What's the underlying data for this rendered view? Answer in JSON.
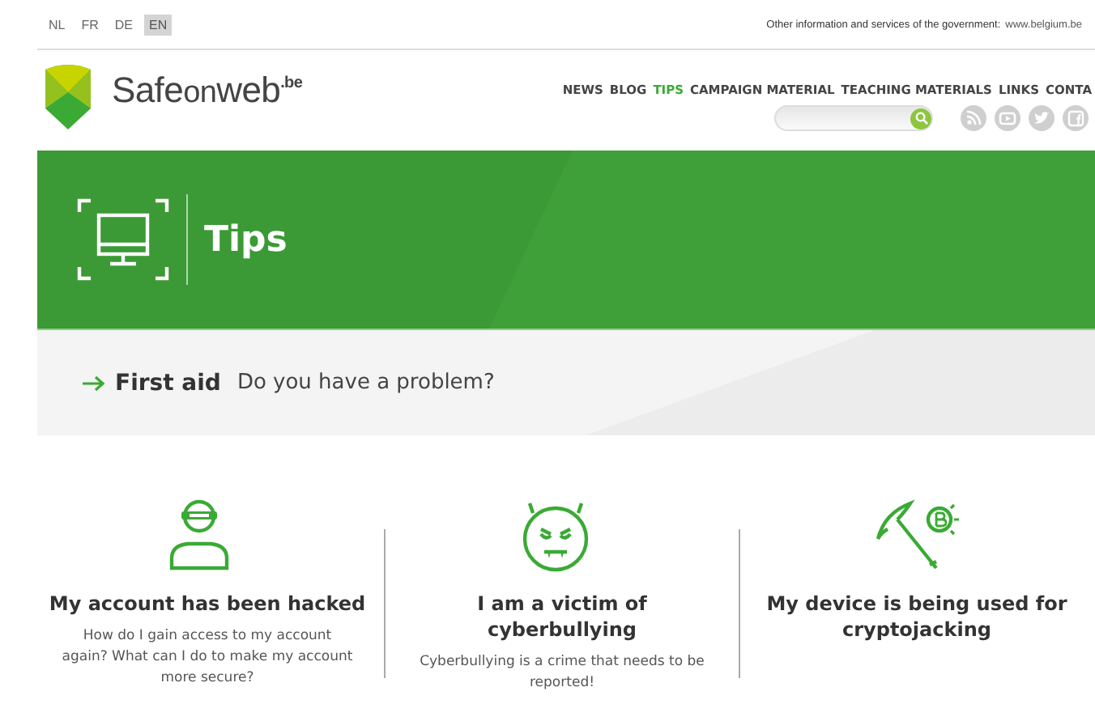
{
  "languages": [
    {
      "label": "NL",
      "selected": false
    },
    {
      "label": "FR",
      "selected": false
    },
    {
      "label": "DE",
      "selected": false
    },
    {
      "label": "EN",
      "selected": true
    }
  ],
  "gov_text": "Other information and services of the government:",
  "gov_link": "www.belgium.be",
  "logo": {
    "name": "Safe",
    "name_accent": "on",
    "name_end": "web",
    "suffix": ".be"
  },
  "nav": [
    {
      "label": "NEWS",
      "selected": false
    },
    {
      "label": "BLOG",
      "selected": false
    },
    {
      "label": "TIPS",
      "selected": true
    },
    {
      "label": "CAMPAIGN MATERIAL",
      "selected": false
    },
    {
      "label": "TEACHING MATERIALS",
      "selected": false
    },
    {
      "label": "LINKS",
      "selected": false
    },
    {
      "label": "CONTA",
      "selected": false
    }
  ],
  "social": [
    {
      "kind": "rss"
    },
    {
      "kind": "youtube"
    },
    {
      "kind": "twitter"
    },
    {
      "kind": "facebook"
    }
  ],
  "banner": {
    "title": "Tips"
  },
  "first_aid": {
    "title": "First aid",
    "subtitle": "Do you have a problem?"
  },
  "cards": [
    {
      "kind": "hacker",
      "title": "My account has been hacked",
      "text": "How do I gain access to my account again? What can I do to make my account more secure?"
    },
    {
      "kind": "devil",
      "title": "I am a victim of cyberbullying",
      "text": "Cyberbullying is a crime that needs to be reported!"
    },
    {
      "kind": "pickaxe",
      "title": "My device is being used for cryptojacking"
    }
  ]
}
